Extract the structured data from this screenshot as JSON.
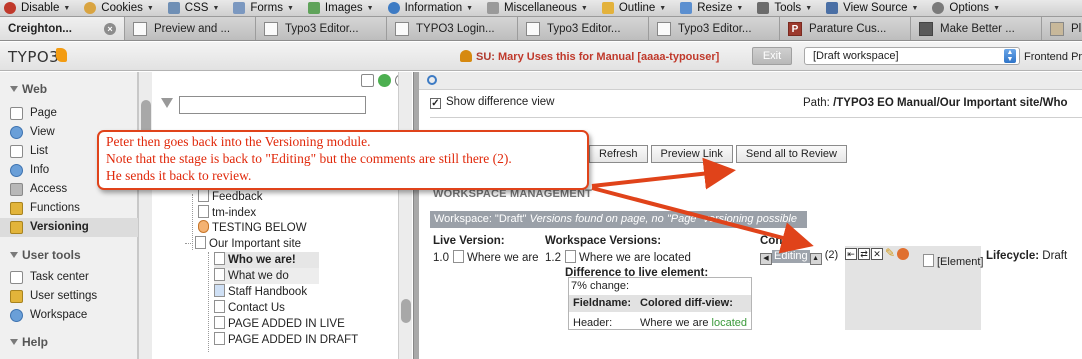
{
  "devbar": {
    "items": [
      {
        "label": "Disable",
        "icon": "disable-icon"
      },
      {
        "label": "Cookies",
        "icon": "cookies-icon"
      },
      {
        "label": "CSS",
        "icon": "css-icon"
      },
      {
        "label": "Forms",
        "icon": "forms-icon"
      },
      {
        "label": "Images",
        "icon": "images-icon"
      },
      {
        "label": "Information",
        "icon": "information-icon"
      },
      {
        "label": "Miscellaneous",
        "icon": "miscellaneous-icon"
      },
      {
        "label": "Outline",
        "icon": "outline-icon"
      },
      {
        "label": "Resize",
        "icon": "resize-icon"
      },
      {
        "label": "Tools",
        "icon": "tools-icon"
      },
      {
        "label": "View Source",
        "icon": "view-source-icon"
      },
      {
        "label": "Options",
        "icon": "options-icon"
      }
    ]
  },
  "tabs": [
    {
      "label": "Creighton...",
      "active": true
    },
    {
      "label": "Preview and ..."
    },
    {
      "label": "Typo3 Editor..."
    },
    {
      "label": "TYPO3 Login..."
    },
    {
      "label": "Typo3 Editor..."
    },
    {
      "label": "Typo3 Editor..."
    },
    {
      "label": "Parature Cus..."
    },
    {
      "label": "Make Better ..."
    },
    {
      "label": "Pl"
    }
  ],
  "topbar": {
    "logo": "TYPO3",
    "su_label": "SU:",
    "su_user": "Mary Uses this for Manual [aaaa-typouser]",
    "exit_label": "Exit",
    "workspace_selected": "[Draft workspace]",
    "frontend_preview": "Frontend Pr"
  },
  "modules": {
    "groups": [
      {
        "label": "Web",
        "items": [
          {
            "label": "Page",
            "icon": "page-icon"
          },
          {
            "label": "View",
            "icon": "view-icon"
          },
          {
            "label": "List",
            "icon": "list-icon"
          },
          {
            "label": "Info",
            "icon": "info-icon"
          },
          {
            "label": "Access",
            "icon": "access-icon"
          },
          {
            "label": "Functions",
            "icon": "functions-icon"
          },
          {
            "label": "Versioning",
            "icon": "versioning-icon",
            "selected": true
          }
        ]
      },
      {
        "label": "User tools",
        "items": [
          {
            "label": "Task center",
            "icon": "task-center-icon"
          },
          {
            "label": "User settings",
            "icon": "user-settings-icon"
          },
          {
            "label": "Workspace",
            "icon": "workspace-icon"
          }
        ]
      },
      {
        "label": "Help",
        "items": []
      }
    ]
  },
  "pagetree": {
    "filter_value": "",
    "items": [
      {
        "label": "Feedback"
      },
      {
        "label": "tm-index"
      },
      {
        "label": "TESTING BELOW"
      },
      {
        "label": "Our Important site"
      },
      {
        "label": "Who we are!"
      },
      {
        "label": "What we do"
      },
      {
        "label": "Staff Handbook"
      },
      {
        "label": "Contact Us"
      },
      {
        "label": "PAGE ADDED IN LIVE"
      },
      {
        "label": "PAGE ADDED IN DRAFT"
      }
    ]
  },
  "content": {
    "show_diff_label": "Show difference view",
    "show_diff_checked": true,
    "path_label": "Path:",
    "path_value": "/TYPO3 EO Manual/Our Important site/Who",
    "buttons": [
      "Refresh",
      "Preview Link",
      "Send all to Review"
    ],
    "section_title": "WORKSPACE MANAGEMENT",
    "workspace_info_prefix": "Workspace: \"Draft\"",
    "workspace_info_rest": "Versions found on page, no \"Page\" versioning possible",
    "col_live": "Live Version:",
    "col_workspace": "Workspace Versions:",
    "col_controls": "Con",
    "live_version": "1.0",
    "live_title": "Where we are",
    "ws_version": "1.2",
    "ws_title": "Where we are located",
    "diff_title": "Difference to live element:",
    "diff_pct": "7% change:",
    "diff_col_fieldname": "Fieldname:",
    "diff_col_colored": "Colored diff-view:",
    "diff_field": "Header:",
    "diff_base": "Where we are",
    "diff_inserted": "located",
    "stage_label": "Editing",
    "comment_count": "(2)",
    "element_label": "[Element]",
    "lifecycle_label": "Lifecycle:",
    "lifecycle_value": "Draft"
  },
  "callout": {
    "lines": [
      "Peter then goes back into the Versioning module.",
      "Note that the stage is back to \"Editing\" but the comments are still there (2).",
      "He sends it back to review."
    ],
    "color": "#e0280a"
  }
}
